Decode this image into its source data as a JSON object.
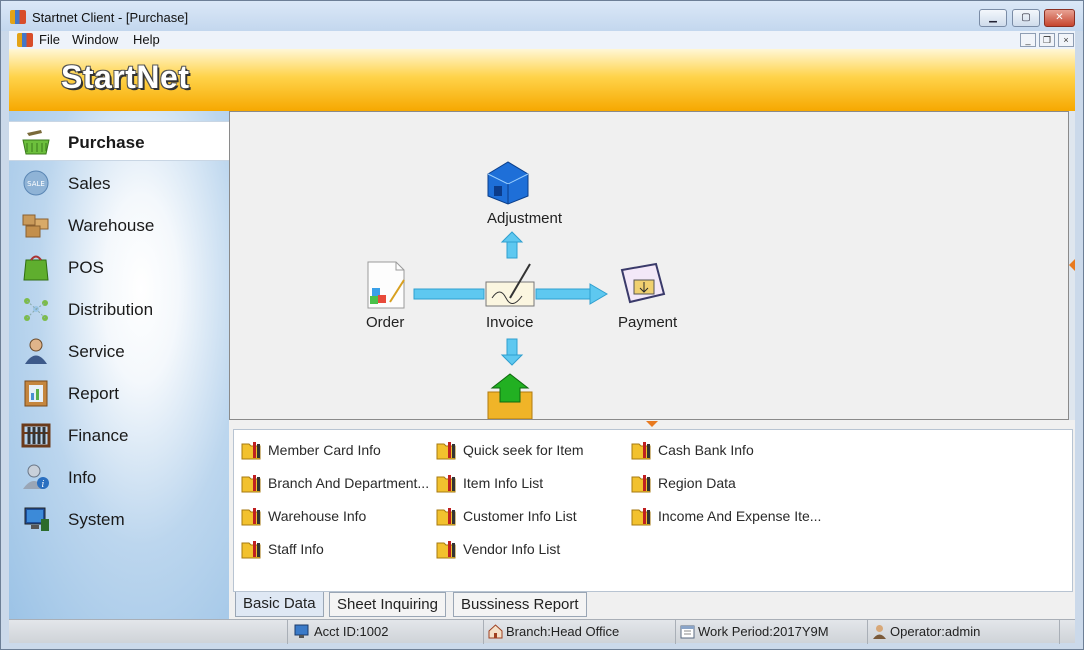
{
  "window": {
    "title": "Startnet Client - [Purchase]",
    "controls": {
      "minimize": "▁",
      "maximize": "▢",
      "close": "✕"
    }
  },
  "menubar": {
    "items": [
      "File",
      "Window",
      "Help"
    ],
    "mdi_controls": {
      "minimize": "_",
      "restore": "❐",
      "close": "×"
    }
  },
  "banner": {
    "logo": "StartNet"
  },
  "sidebar": {
    "items": [
      {
        "label": "Purchase",
        "icon": "shopping-basket-icon",
        "active": true
      },
      {
        "label": "Sales",
        "icon": "sale-badge-icon"
      },
      {
        "label": "Warehouse",
        "icon": "boxes-icon"
      },
      {
        "label": "POS",
        "icon": "bag-icon"
      },
      {
        "label": "Distribution",
        "icon": "distribution-icon"
      },
      {
        "label": "Service",
        "icon": "user-service-icon"
      },
      {
        "label": "Report",
        "icon": "report-book-icon"
      },
      {
        "label": "Finance",
        "icon": "abacus-icon"
      },
      {
        "label": "Info",
        "icon": "user-info-icon"
      },
      {
        "label": "System",
        "icon": "computer-icon"
      }
    ]
  },
  "flow": {
    "order": "Order",
    "invoice": "Invoice",
    "payment": "Payment",
    "adjustment": "Adjustment"
  },
  "quick_links": {
    "column1": [
      "Member Card Info",
      "Branch And Department...",
      "Warehouse Info",
      "Staff Info"
    ],
    "column2": [
      "Quick seek for Item",
      "Item Info List",
      "Customer Info List",
      "Vendor Info List"
    ],
    "column3": [
      "Cash Bank Info",
      "Region Data",
      "Income And Expense Ite..."
    ]
  },
  "tabs": [
    {
      "label": "Basic Data",
      "active": true
    },
    {
      "label": "Sheet Inquiring"
    },
    {
      "label": "Bussiness Report"
    }
  ],
  "status": {
    "acct": "Acct ID:1002",
    "branch": "Branch:Head Office",
    "period": "Work Period:2017Y9M",
    "operator": "Operator:admin"
  },
  "colors": {
    "banner_yellow": "#ffd34a",
    "banner_orange": "#f6a800",
    "flow_arrow": "#5ec8f0",
    "sidebar_blue": "#9cc3e6"
  }
}
